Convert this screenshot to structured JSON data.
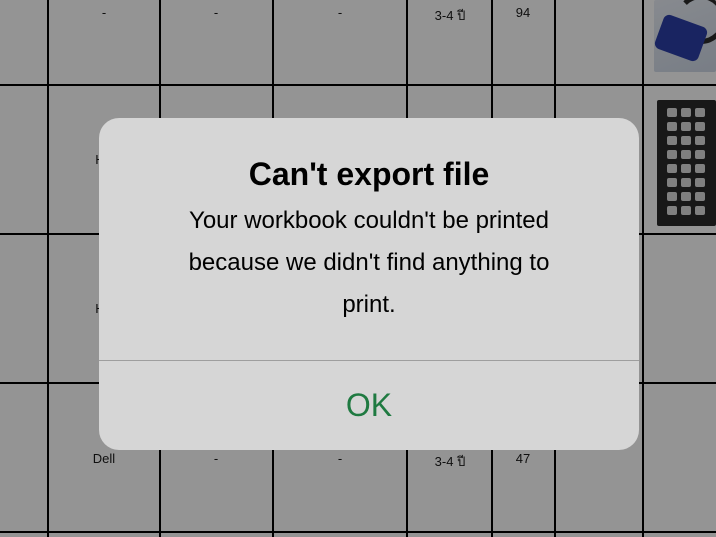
{
  "spreadsheet": {
    "rows": [
      {
        "brand": "",
        "col2": "-",
        "col3": "-",
        "col4": "-",
        "warranty": "3-4 ปี",
        "count": "94",
        "image": "vga-cable-image"
      },
      {
        "brand": "H",
        "col2": "",
        "col3": "",
        "col4": "",
        "warranty": "",
        "count": "",
        "image": "keyboard-image"
      },
      {
        "brand": "H",
        "col2": "",
        "col3": "",
        "col4": "",
        "warranty": "",
        "count": "",
        "image": ""
      },
      {
        "brand": "Dell",
        "col2": "-",
        "col3": "-",
        "col4": "",
        "warranty": "3-4 ปี",
        "count": "47",
        "image": ""
      }
    ]
  },
  "alert": {
    "title": "Can't export file",
    "message_lines": [
      "Your workbook couldn't be printed",
      "because we didn't find anything to",
      "print."
    ],
    "ok_label": "OK",
    "ok_color": "#1f7a41"
  }
}
